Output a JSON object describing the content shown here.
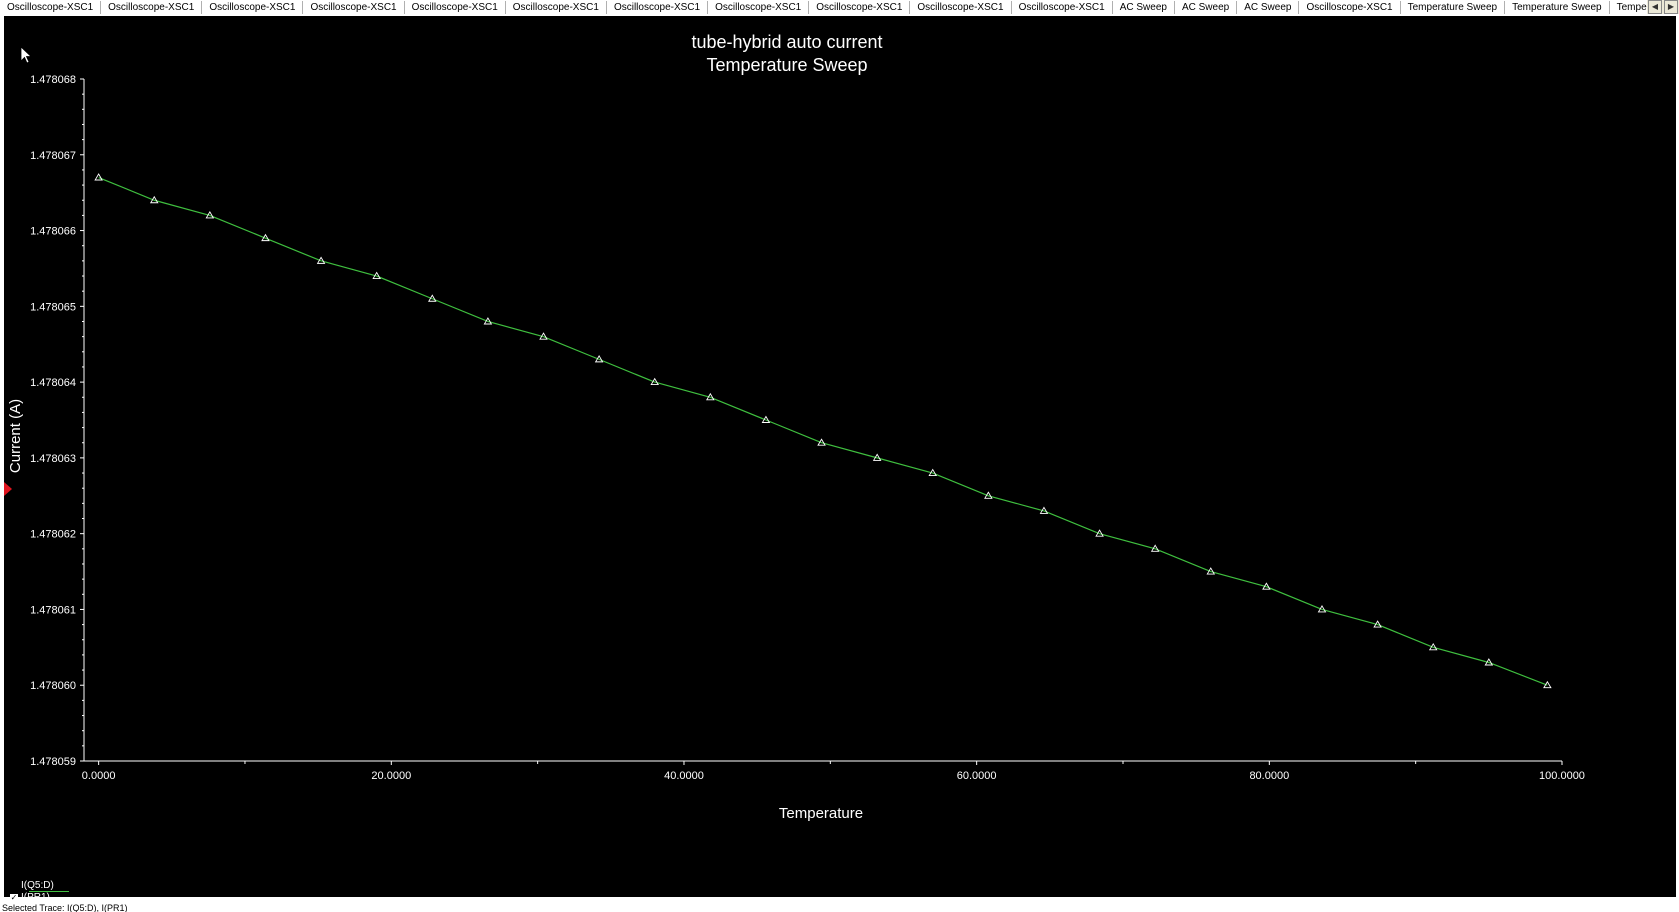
{
  "tabs": [
    {
      "label": "Oscilloscope-XSC1"
    },
    {
      "label": "Oscilloscope-XSC1"
    },
    {
      "label": "Oscilloscope-XSC1"
    },
    {
      "label": "Oscilloscope-XSC1"
    },
    {
      "label": "Oscilloscope-XSC1"
    },
    {
      "label": "Oscilloscope-XSC1"
    },
    {
      "label": "Oscilloscope-XSC1"
    },
    {
      "label": "Oscilloscope-XSC1"
    },
    {
      "label": "Oscilloscope-XSC1"
    },
    {
      "label": "Oscilloscope-XSC1"
    },
    {
      "label": "Oscilloscope-XSC1"
    },
    {
      "label": "AC Sweep"
    },
    {
      "label": "AC Sweep"
    },
    {
      "label": "AC Sweep"
    },
    {
      "label": "Oscilloscope-XSC1"
    },
    {
      "label": "Temperature Sweep"
    },
    {
      "label": "Temperature Sweep"
    },
    {
      "label": "Temperat"
    }
  ],
  "status_text": "Selected Trace: I(Q5:D), I(PR1)",
  "colors": {
    "background": "#000000",
    "trace": "#3fbf3f",
    "axis": "#ffffff",
    "marker": "#ffffff",
    "text": "#ffffff"
  },
  "chart_data": {
    "type": "line",
    "title": "tube-hybrid auto current",
    "subtitle": "Temperature Sweep",
    "xlabel": "Temperature",
    "ylabel": "Current (A)",
    "xlim": [
      -1.0,
      100.0
    ],
    "ylim": [
      1.478059,
      1.478068
    ],
    "x_ticks": [
      0,
      20,
      40,
      60,
      80,
      100
    ],
    "x_tick_labels": [
      "0.0000",
      "20.0000",
      "40.0000",
      "60.0000",
      "80.0000",
      "100.0000"
    ],
    "y_ticks": [
      1.478059,
      1.47806,
      1.478061,
      1.478062,
      1.478063,
      1.478064,
      1.478065,
      1.478066,
      1.478067,
      1.478068
    ],
    "y_tick_labels": [
      "1.478059",
      "1.478060",
      "1.478061",
      "1.478062",
      "1.478063",
      "1.478064",
      "1.478065",
      "1.478066",
      "1.478067",
      "1.478068"
    ],
    "grid": false,
    "legend_position": "bottom-left",
    "series": [
      {
        "name": "I(Q5:D)",
        "x": [
          0,
          3.8,
          7.6,
          11.4,
          15.2,
          19.0,
          22.8,
          26.6,
          30.4,
          34.2,
          38.0,
          41.8,
          45.6,
          49.4,
          53.2,
          57.0,
          60.8,
          64.6,
          68.4,
          72.2,
          76.0,
          79.8,
          83.6,
          87.4,
          91.2,
          95.0,
          99.0
        ],
        "values": [
          1.4780667,
          1.4780664,
          1.4780662,
          1.4780659,
          1.4780656,
          1.4780654,
          1.4780651,
          1.4780648,
          1.4780646,
          1.4780643,
          1.478064,
          1.4780638,
          1.4780635,
          1.4780632,
          1.478063,
          1.4780628,
          1.4780625,
          1.4780623,
          1.478062,
          1.4780618,
          1.4780615,
          1.4780613,
          1.478061,
          1.4780608,
          1.4780605,
          1.4780603,
          1.47806
        ]
      }
    ],
    "legend_entries": [
      "I(Q5:D)",
      "I(PR1)"
    ]
  }
}
